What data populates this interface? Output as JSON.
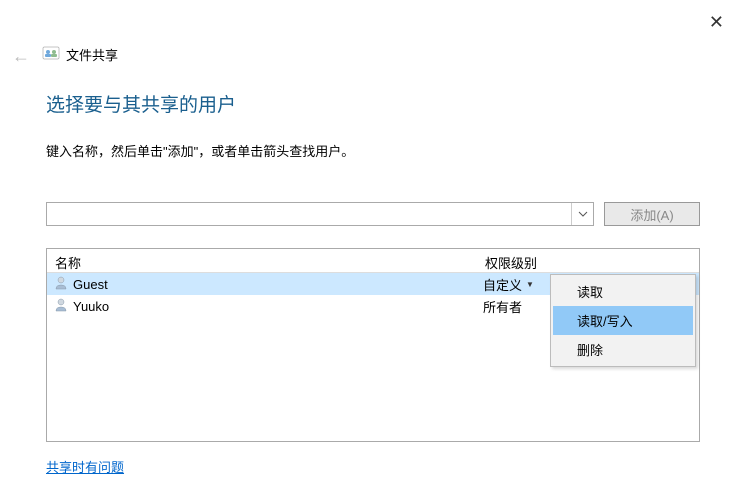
{
  "window": {
    "title": "文件共享"
  },
  "heading": "选择要与其共享的用户",
  "instruction": "键入名称，然后单击\"添加\"，或者单击箭头查找用户。",
  "search": {
    "value": "",
    "add_label": "添加(A)"
  },
  "table": {
    "col_name": "名称",
    "col_perm": "权限级别",
    "rows": [
      {
        "name": "Guest",
        "perm": "自定义",
        "selected": true,
        "dropdown": true
      },
      {
        "name": "Yuuko",
        "perm": "所有者",
        "selected": false,
        "dropdown": false
      }
    ]
  },
  "context_menu": {
    "items": [
      "读取",
      "读取/写入",
      "删除"
    ],
    "highlighted_index": 1
  },
  "help_link": "共享时有问题"
}
